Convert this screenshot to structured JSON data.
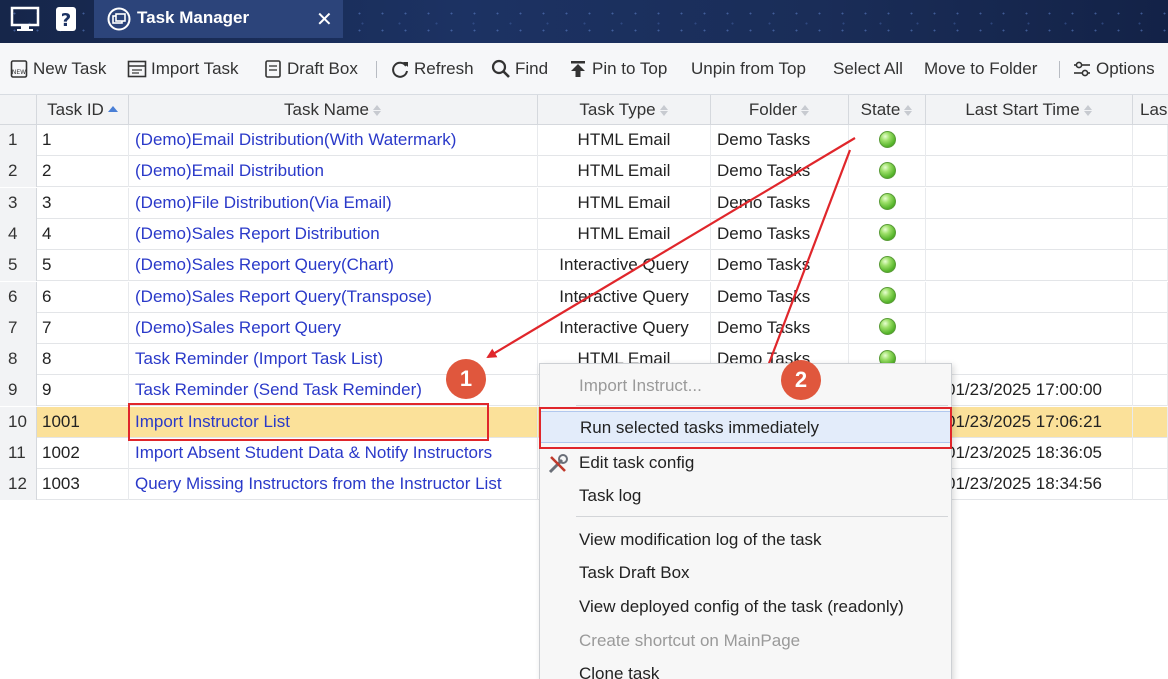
{
  "titlebar": {
    "icons": [
      "monitor-icon",
      "help-icon"
    ],
    "tab": {
      "label": "Task Manager",
      "icon": "task-manager-icon",
      "close": "✕"
    }
  },
  "toolbar": {
    "new_task": "New Task",
    "import_task": "Import Task",
    "draft_box": "Draft Box",
    "refresh": "Refresh",
    "find": "Find",
    "pin_to_top": "Pin to Top",
    "unpin_from_top": "Unpin from Top",
    "select_all": "Select All",
    "move_to_folder": "Move to Folder",
    "options": "Options"
  },
  "grid": {
    "headers": {
      "task_id": "Task ID",
      "task_name": "Task Name",
      "task_type": "Task Type",
      "folder": "Folder",
      "state": "State",
      "last_start_time": "Last Start Time",
      "last_more": "Las"
    },
    "rows": [
      {
        "num": "1",
        "id": "1",
        "name": "(Demo)Email Distribution(With Watermark)",
        "type": "HTML Email",
        "folder": "Demo Tasks",
        "state": "green",
        "last": ""
      },
      {
        "num": "2",
        "id": "2",
        "name": "(Demo)Email Distribution",
        "type": "HTML Email",
        "folder": "Demo Tasks",
        "state": "green",
        "last": ""
      },
      {
        "num": "3",
        "id": "3",
        "name": "(Demo)File Distribution(Via Email)",
        "type": "HTML Email",
        "folder": "Demo Tasks",
        "state": "green",
        "last": ""
      },
      {
        "num": "4",
        "id": "4",
        "name": "(Demo)Sales Report Distribution",
        "type": "HTML Email",
        "folder": "Demo Tasks",
        "state": "green",
        "last": ""
      },
      {
        "num": "5",
        "id": "5",
        "name": "(Demo)Sales Report Query(Chart)",
        "type": "Interactive Query",
        "folder": "Demo Tasks",
        "state": "green",
        "last": ""
      },
      {
        "num": "6",
        "id": "6",
        "name": "(Demo)Sales Report Query(Transpose)",
        "type": "Interactive Query",
        "folder": "Demo Tasks",
        "state": "green",
        "last": ""
      },
      {
        "num": "7",
        "id": "7",
        "name": "(Demo)Sales Report Query",
        "type": "Interactive Query",
        "folder": "Demo Tasks",
        "state": "green",
        "last": ""
      },
      {
        "num": "8",
        "id": "8",
        "name": "Task Reminder (Import Task List)",
        "type": "HTML Email",
        "folder": "Demo Tasks",
        "state": "green",
        "last": ""
      },
      {
        "num": "9",
        "id": "9",
        "name": "Task Reminder (Send Task Reminder)",
        "type": "",
        "folder": "",
        "state": "",
        "last": "01/23/2025 17:00:00"
      },
      {
        "num": "10",
        "id": "1001",
        "name": "Import Instructor List",
        "type": "",
        "folder": "",
        "state": "",
        "last": "01/23/2025 17:06:21"
      },
      {
        "num": "11",
        "id": "1002",
        "name": "Import Absent Student Data & Notify Instructors",
        "type": "",
        "folder": "",
        "state": "",
        "last": "01/23/2025 18:36:05"
      },
      {
        "num": "12",
        "id": "1003",
        "name": "Query Missing Instructors from the Instructor List",
        "type": "",
        "folder": "",
        "state": "",
        "last": "01/23/2025 18:34:56"
      }
    ],
    "selected_row_index": 9
  },
  "context_menu": {
    "items": {
      "import_instructor": "Import Instruct...",
      "run_immediately": "Run selected tasks immediately",
      "edit_config": "Edit task config",
      "task_log": "Task log",
      "view_mod_log": "View modification log of the task",
      "task_draft_box": "Task Draft Box",
      "view_deployed": "View deployed config of the task (readonly)",
      "create_shortcut": "Create shortcut on MainPage",
      "clone_task": "Clone task"
    }
  },
  "annotations": {
    "badge1": "1",
    "badge2": "2",
    "color": "#e0262b"
  }
}
